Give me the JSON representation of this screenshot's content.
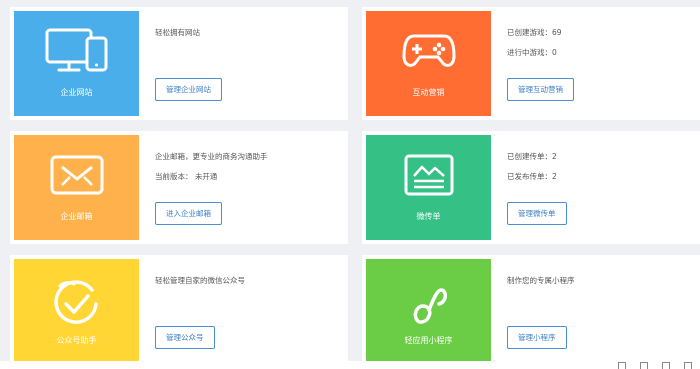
{
  "cards": [
    {
      "tile_label": "企业网站",
      "tile_color": "#4aaeea",
      "icon": "computer-monitor-icon",
      "lines": [
        "轻松拥有网站"
      ],
      "button": "管理企业网站"
    },
    {
      "tile_label": "互动营销",
      "tile_color": "#ff6d33",
      "icon": "gamepad-icon",
      "lines": [
        "已创建游戏：69",
        "进行中游戏：0"
      ],
      "button": "管理互动营销"
    },
    {
      "tile_label": "企业邮箱",
      "tile_color": "#ffb24c",
      "icon": "envelope-icon",
      "lines": [
        "企业邮箱，更专业的商务沟通助手",
        "当前版本：  未开通"
      ],
      "button": "进入企业邮箱"
    },
    {
      "tile_label": "微传单",
      "tile_color": "#35c086",
      "icon": "leaflet-icon",
      "lines": [
        "已创建传单：2",
        "已发布传单：2"
      ],
      "button": "管理微传单"
    },
    {
      "tile_label": "公众号助手",
      "tile_color": "#ffd633",
      "icon": "checkmark-circle-icon",
      "lines": [
        "轻松管理自家的微信公众号"
      ],
      "button": "管理公众号"
    },
    {
      "tile_label": "轻应用小程序",
      "tile_color": "#6bcc45",
      "icon": "mini-program-icon",
      "lines": [
        "制作您的专属小程序"
      ],
      "button": "管理小程序"
    }
  ]
}
